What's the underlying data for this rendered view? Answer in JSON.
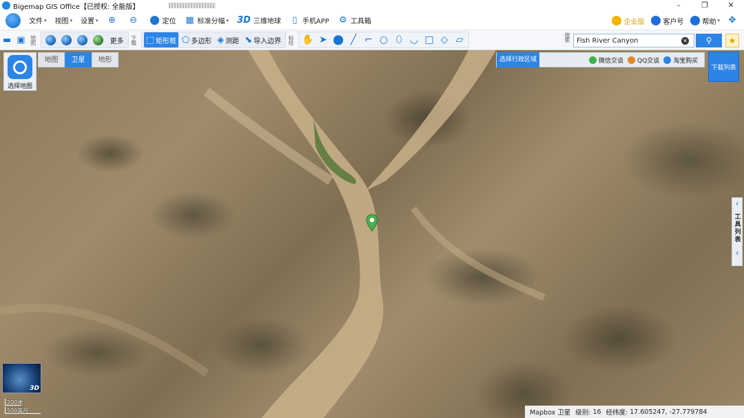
{
  "window": {
    "title": "Bigemap GIS Office【已授权: 全能版】",
    "controls": [
      "–",
      "❐",
      "✕"
    ]
  },
  "menu": {
    "file": "文件",
    "view": "视图",
    "settings": "设置",
    "locate": "定位",
    "standard_tiles": "标准分幅",
    "three_d": "3D",
    "three_d_globe": "三维地球",
    "mobile_app": "手机APP",
    "toolbox": "工具箱",
    "enterprise": "企业版",
    "customer_id": "客户号",
    "help": "帮助"
  },
  "toolbar": {
    "map_label": "地图",
    "more": "更多",
    "download_label": "下载",
    "rectangle": "矩形框",
    "polygon": "多边形",
    "measure": "测距",
    "import_boundary": "导入边界",
    "annotate_label": "标绘",
    "search_label": "搜索",
    "search_value": "Fish River Canyon",
    "search_icon": "search-icon"
  },
  "map": {
    "tabs": [
      "地图",
      "卫星",
      "地形"
    ],
    "active_tab": "卫星",
    "select_map": "选择地图",
    "region_select": "选择行政区域",
    "wechat": "微信交谈",
    "qq": "QQ交谈",
    "taobao": "淘宝购买",
    "download_list": "下载列表",
    "tool_list": "工具列表",
    "globe_label": "3D",
    "scale_short": "200米",
    "scale_long": "500英尺"
  },
  "status": {
    "source": "Mapbox 卫星",
    "level_label": "级别:",
    "level": "16",
    "coord_label": "经纬度:",
    "coords": "17.605247, -27.779784"
  },
  "colors": {
    "accent": "#2c84e6",
    "pin": "#4caf50",
    "river": "#5d7a3e"
  }
}
